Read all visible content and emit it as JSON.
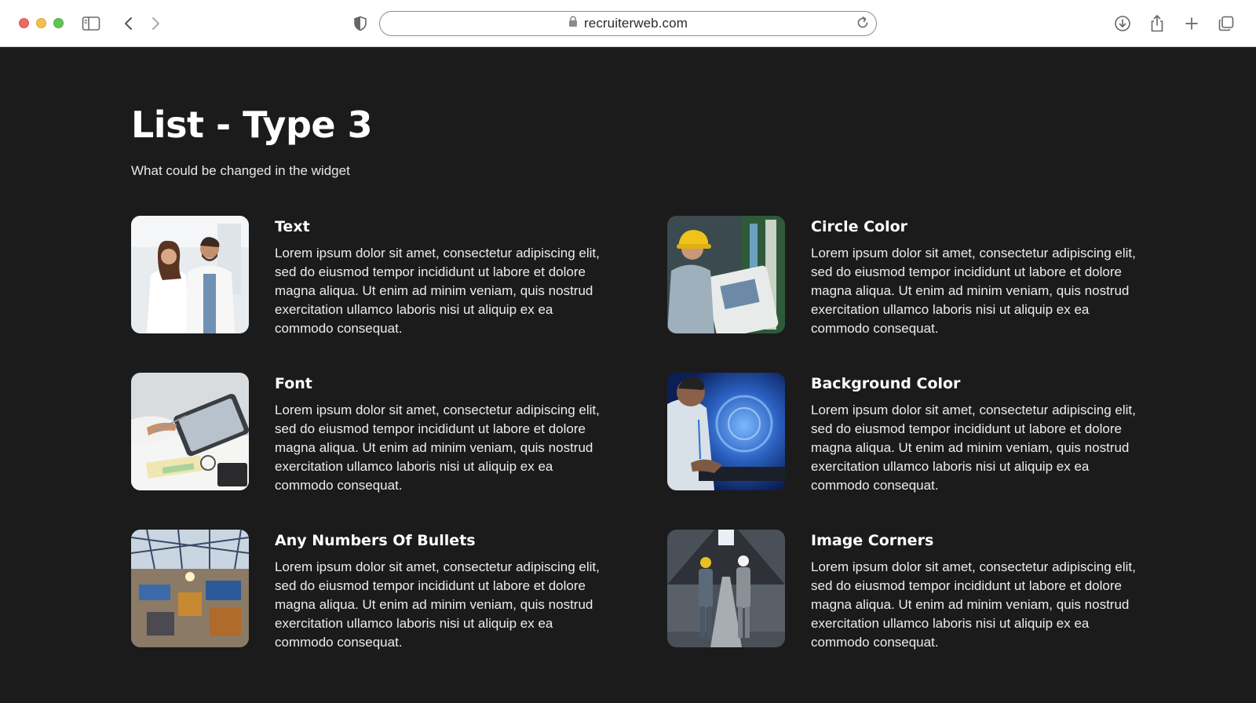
{
  "browser": {
    "url": "recruiterweb.com"
  },
  "page": {
    "title": "List - Type 3",
    "subtitle": "What could be changed in the widget"
  },
  "items": [
    {
      "title": "Text",
      "body": "Lorem ipsum dolor sit amet, consectetur adipiscing elit, sed do eiusmod tempor incididunt ut labore et dolore magna aliqua. Ut enim ad minim veniam, quis nostrud exercitation ullamco laboris nisi ut aliquip ex ea commodo consequat."
    },
    {
      "title": "Circle Color",
      "body": "Lorem ipsum dolor sit amet, consectetur adipiscing elit, sed do eiusmod tempor incididunt ut labore et dolore magna aliqua. Ut enim ad minim veniam, quis nostrud exercitation ullamco laboris nisi ut aliquip ex ea commodo consequat."
    },
    {
      "title": "Font",
      "body": "Lorem ipsum dolor sit amet, consectetur adipiscing elit, sed do eiusmod tempor incididunt ut labore et dolore magna aliqua. Ut enim ad minim veniam, quis nostrud exercitation ullamco laboris nisi ut aliquip ex ea commodo consequat."
    },
    {
      "title": "Background Color",
      "body": "Lorem ipsum dolor sit amet, consectetur adipiscing elit, sed do eiusmod tempor incididunt ut labore et dolore magna aliqua. Ut enim ad minim veniam, quis nostrud exercitation ullamco laboris nisi ut aliquip ex ea commodo consequat."
    },
    {
      "title": "Any Numbers Of Bullets",
      "body": "Lorem ipsum dolor sit amet, consectetur adipiscing elit, sed do eiusmod tempor incididunt ut labore et dolore magna aliqua. Ut enim ad minim veniam, quis nostrud exercitation ullamco laboris nisi ut aliquip ex ea commodo consequat."
    },
    {
      "title": "Image Corners",
      "body": "Lorem ipsum dolor sit amet, consectetur adipiscing elit, sed do eiusmod tempor incididunt ut labore et dolore magna aliqua. Ut enim ad minim veniam, quis nostrud exercitation ullamco laboris nisi ut aliquip ex ea commodo consequat."
    }
  ],
  "icons": {
    "sidebar": "sidebar-icon",
    "back": "chevron-left-icon",
    "forward": "chevron-right-icon",
    "privacy": "shield-icon",
    "lock": "lock-icon",
    "reload": "reload-icon",
    "download": "download-icon",
    "share": "share-icon",
    "new_tab": "plus-icon",
    "tabs": "tabs-overview-icon"
  },
  "colors": {
    "background": "#1b1b1c",
    "chrome": "#ffffff",
    "text": "#ffffff"
  }
}
